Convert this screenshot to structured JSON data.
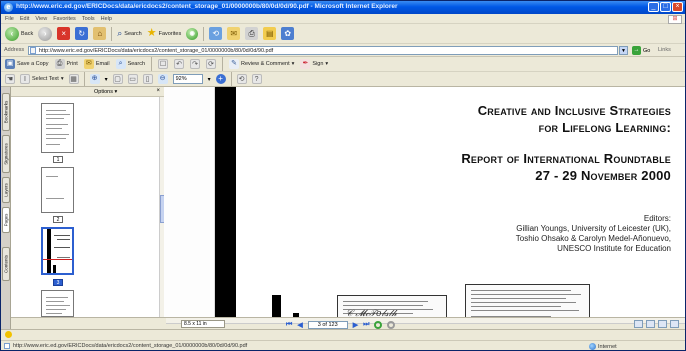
{
  "window": {
    "title": "http://www.eric.ed.gov/ERICDocs/data/ericdocs2/content_storage_01/0000000b/80/0d/0d/90.pdf - Microsoft Internet Explorer",
    "controls": [
      "_",
      "□",
      "×"
    ]
  },
  "menubar": {
    "items": [
      "File",
      "Edit",
      "View",
      "Favorites",
      "Tools",
      "Help"
    ]
  },
  "navbar": {
    "back_label": "Back",
    "search_label": "Search",
    "favorites_label": "Favorites"
  },
  "address": {
    "label": "Address",
    "url": "http://www.eric.ed.gov/ERICDocs/data/ericdocs2/content_storage_01/0000000b/80/0d/0d/90.pdf",
    "go_label": "Go",
    "links_label": "Links"
  },
  "adobe_toolbar": {
    "save_copy": "Save a Copy",
    "print": "Print",
    "email": "Email",
    "search": "Search",
    "review_comment": "Review & Comment",
    "sign": "Sign",
    "select_text": "Select Text",
    "zoom": "92%"
  },
  "nav_tabs": [
    "Bookmarks",
    "Signatures",
    "Layers",
    "Pages",
    "Contents"
  ],
  "pages_panel": {
    "options_label": "Options",
    "close": "×",
    "thumbnails": [
      {
        "number": "1",
        "selected": false
      },
      {
        "number": "2",
        "selected": false
      },
      {
        "number": "3",
        "selected": true
      }
    ]
  },
  "document": {
    "title_line1": "Creative and Inclusive Strategies",
    "title_line2": "for Lifelong Learning:",
    "subtitle_line1": "Report of International Roundtable",
    "subtitle_line2": "27 - 29 November 2000",
    "editors_heading": "Editors:",
    "editor1": "Gillian Youngs, University of Leicester (UK),",
    "editor2": "Toshio Ohsako & Carolyn Medel-Añonuevo,",
    "editor3": "UNESCO Institute for Education"
  },
  "doc_status": {
    "page_size": "8.5 x 11 in",
    "page_indicator": "3 of 123"
  },
  "ie_status": {
    "url": "http://www.eric.ed.gov/ERICDocs/data/ericdocs2/content_storage_01/0000000b/80/0d/0d/90.pdf",
    "zone": "Internet"
  },
  "colors": {
    "titlebar": "#0058e6",
    "chrome": "#ece9d8",
    "selected_page": "#2c5fd0"
  }
}
